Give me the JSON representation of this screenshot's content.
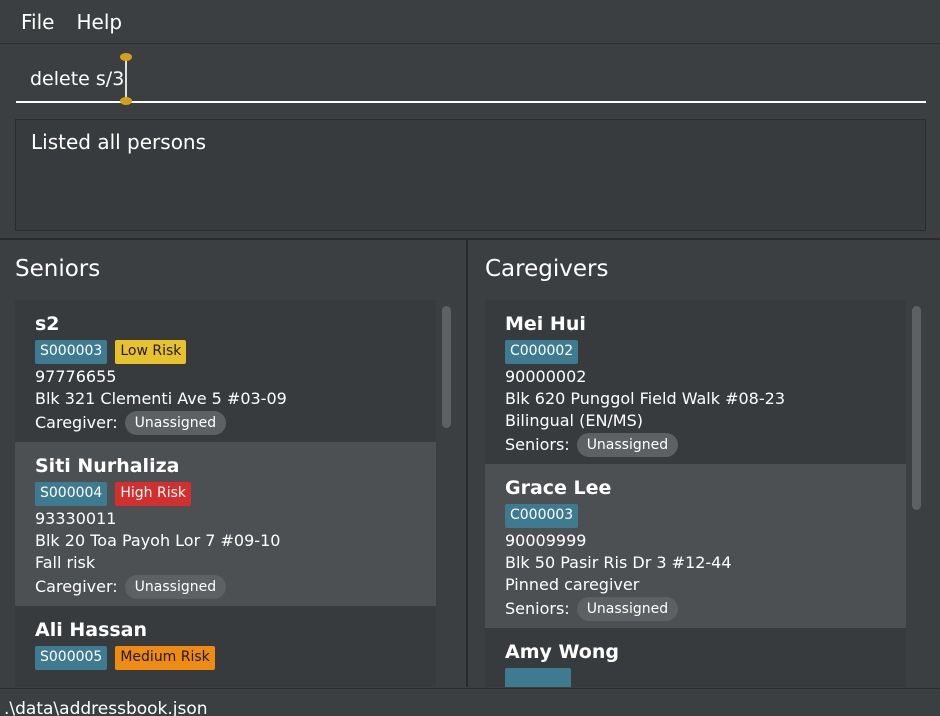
{
  "menu": {
    "file": "File",
    "help": "Help"
  },
  "command": {
    "value": "delete s/3"
  },
  "result": {
    "text": "Listed all persons"
  },
  "seniors": {
    "title": "Seniors",
    "cards": [
      {
        "name": "s2",
        "id": "S000003",
        "risk": "Low Risk",
        "phone": "97776655",
        "address": "Blk 321 Clementi Ave 5 #03-09",
        "note": "",
        "assign_label": "Caregiver:",
        "assign_value": "Unassigned"
      },
      {
        "name": "Siti Nurhaliza",
        "id": "S000004",
        "risk": "High Risk",
        "phone": "93330011",
        "address": "Blk 20 Toa Payoh Lor 7 #09-10",
        "note": "Fall risk",
        "assign_label": "Caregiver:",
        "assign_value": "Unassigned"
      },
      {
        "name": "Ali Hassan",
        "id": "S000005",
        "risk": "Medium Risk"
      }
    ]
  },
  "caregivers": {
    "title": "Caregivers",
    "cards": [
      {
        "name": "Mei Hui",
        "id": "C000002",
        "phone": "90000002",
        "address": "Blk 620 Punggol Field Walk #08-23",
        "note": "Bilingual (EN/MS)",
        "assign_label": "Seniors:",
        "assign_value": "Unassigned"
      },
      {
        "name": "Grace Lee",
        "id": "C000003",
        "phone": "90009999",
        "address": "Blk 50 Pasir Ris Dr 3 #12-44",
        "note": "Pinned caregiver",
        "assign_label": "Seniors:",
        "assign_value": "Unassigned"
      },
      {
        "name": "Amy Wong"
      }
    ]
  },
  "status": {
    "path": ".\\data\\addressbook.json"
  },
  "colors": {
    "background": "#3c3f41",
    "id_tag": "#3e7b91",
    "low_risk": "#e8c22c",
    "high_risk": "#d32f2f",
    "medium_risk": "#ef8b12"
  }
}
